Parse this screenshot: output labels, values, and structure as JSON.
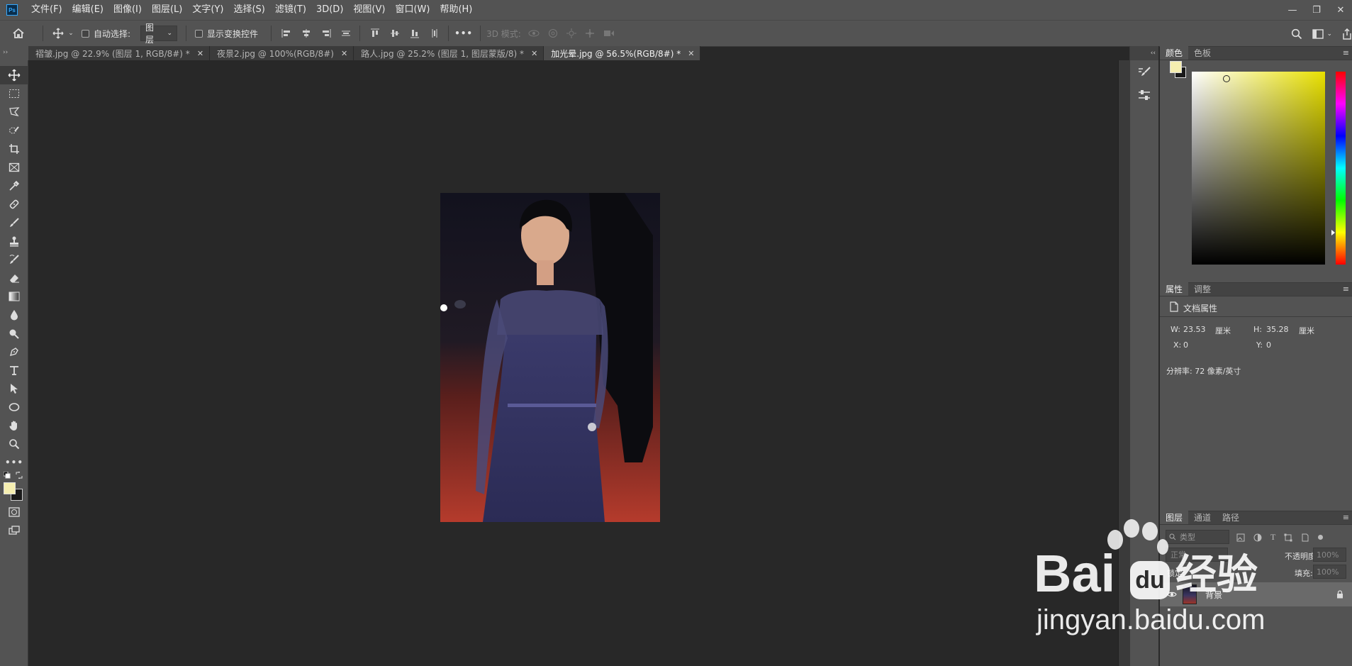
{
  "app": {
    "logo_text": "Ps"
  },
  "menu": [
    "文件(F)",
    "编辑(E)",
    "图像(I)",
    "图层(L)",
    "文字(Y)",
    "选择(S)",
    "滤镜(T)",
    "3D(D)",
    "视图(V)",
    "窗口(W)",
    "帮助(H)"
  ],
  "window_controls": {
    "minimize": "—",
    "restore": "❐",
    "close": "✕"
  },
  "options": {
    "auto_select_label": "自动选择:",
    "auto_select_target": "图层",
    "show_transform_label": "显示变换控件",
    "mode_3d_label": "3D 模式:",
    "more": "•••"
  },
  "tabs": [
    {
      "label": "褶皱.jpg @ 22.9% (图层 1, RGB/8#) *",
      "active": false
    },
    {
      "label": "夜景2.jpg @ 100%(RGB/8#)",
      "active": false
    },
    {
      "label": "路人.jpg @ 25.2% (图层 1, 图层蒙版/8) *",
      "active": false
    },
    {
      "label": "加光晕.jpg @ 56.5%(RGB/8#) *",
      "active": true
    }
  ],
  "tab_close": "✕",
  "color_panel": {
    "tabs": [
      "颜色",
      "色板"
    ],
    "foreground": "#f5eeb0",
    "background": "#1a1a1a",
    "hue_color": "#e8e000"
  },
  "properties_panel": {
    "tabs": [
      "属性",
      "调整"
    ],
    "doc_label": "文档属性",
    "w_label": "W:",
    "w_value": "23.53",
    "w_unit": "厘米",
    "h_label": "H:",
    "h_value": "35.28",
    "h_unit": "厘米",
    "x_label": "X:",
    "x_value": "0",
    "y_label": "Y:",
    "y_value": "0",
    "resolution": "分辨率: 72 像素/英寸"
  },
  "layers_panel": {
    "tabs": [
      "图层",
      "通道",
      "路径"
    ],
    "filter_placeholder": "类型",
    "blend_mode": "正常",
    "opacity_label": "不透明度:",
    "opacity_value": "100%",
    "lock_label": "锁定:",
    "fill_label": "填充:",
    "fill_value": "100%",
    "layers": [
      {
        "name": "背景",
        "locked": true,
        "visible": true
      }
    ]
  },
  "watermark": {
    "brand": "Bai",
    "brand_cn": "经验",
    "url": "jingyan.baidu.com"
  },
  "panel_menu": "≡"
}
